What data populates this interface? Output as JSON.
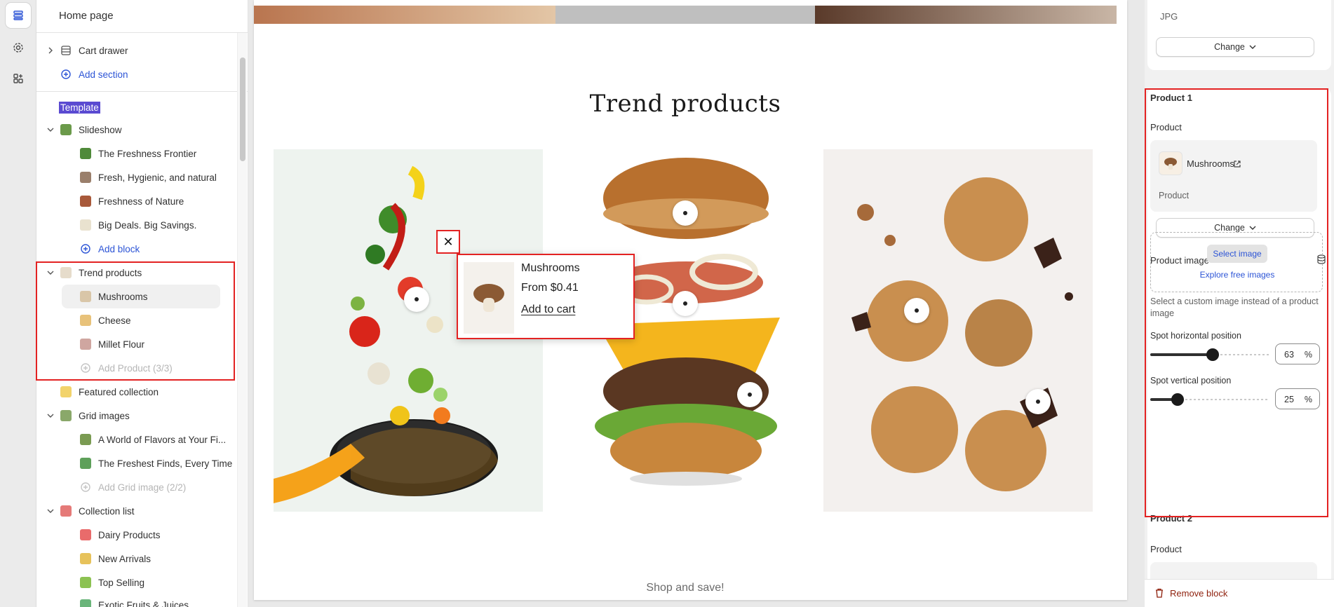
{
  "sidebar": {
    "title": "Home page",
    "header_rows": [
      {
        "label": "Cart drawer"
      },
      {
        "label": "Add section"
      }
    ],
    "template_label": "Template",
    "slideshow": {
      "label": "Slideshow",
      "items": [
        "The Freshness Frontier",
        "Fresh, Hygienic, and natural",
        "Freshness of Nature",
        "Big Deals. Big Savings."
      ],
      "add_label": "Add block"
    },
    "trend": {
      "label": "Trend products",
      "items": [
        "Mushrooms",
        "Cheese",
        "Millet Flour"
      ],
      "add_label": "Add Product (3/3)"
    },
    "featured": {
      "label": "Featured collection"
    },
    "grid": {
      "label": "Grid images",
      "items": [
        "A World of Flavors at Your Fi...",
        "The Freshest Finds, Every Time"
      ],
      "add_label": "Add Grid image (2/2)"
    },
    "collection": {
      "label": "Collection list",
      "items": [
        "Dairy Products",
        "New Arrivals",
        "Top Selling",
        "Exotic Fruits & Juices"
      ]
    }
  },
  "preview": {
    "section_title": "Trend products",
    "popup": {
      "name": "Mushrooms",
      "price": "From $0.41",
      "cta": "Add to cart"
    },
    "close_symbol": "✕",
    "footer_text": "Shop and save!"
  },
  "rpanel": {
    "top_card": {
      "file_type": "JPG",
      "change_label": "Change"
    },
    "product1": {
      "heading": "Product 1",
      "product_label": "Product",
      "product_name": "Mushrooms",
      "product_sub": "Product",
      "change_label": "Change",
      "image_label": "Product image",
      "select_image": "Select image",
      "explore": "Explore free images",
      "help": "Select a custom image instead of a product image",
      "h_label": "Spot horizontal position",
      "h_value": "63",
      "v_label": "Spot vertical position",
      "v_value": "25",
      "unit": "%"
    },
    "product2": {
      "heading": "Product 2",
      "product_label": "Product"
    },
    "remove_label": "Remove block"
  },
  "colors": {
    "accent": "#2c54d6",
    "highlight": "#e32222",
    "danger": "#8e1f0b",
    "template_bg": "#5a4ad1"
  },
  "icons": {
    "rail": [
      "sections-icon",
      "gear-icon",
      "apps-icon"
    ],
    "close": "close-icon",
    "external": "external-link-icon",
    "database": "database-icon",
    "delete": "trash-icon"
  }
}
